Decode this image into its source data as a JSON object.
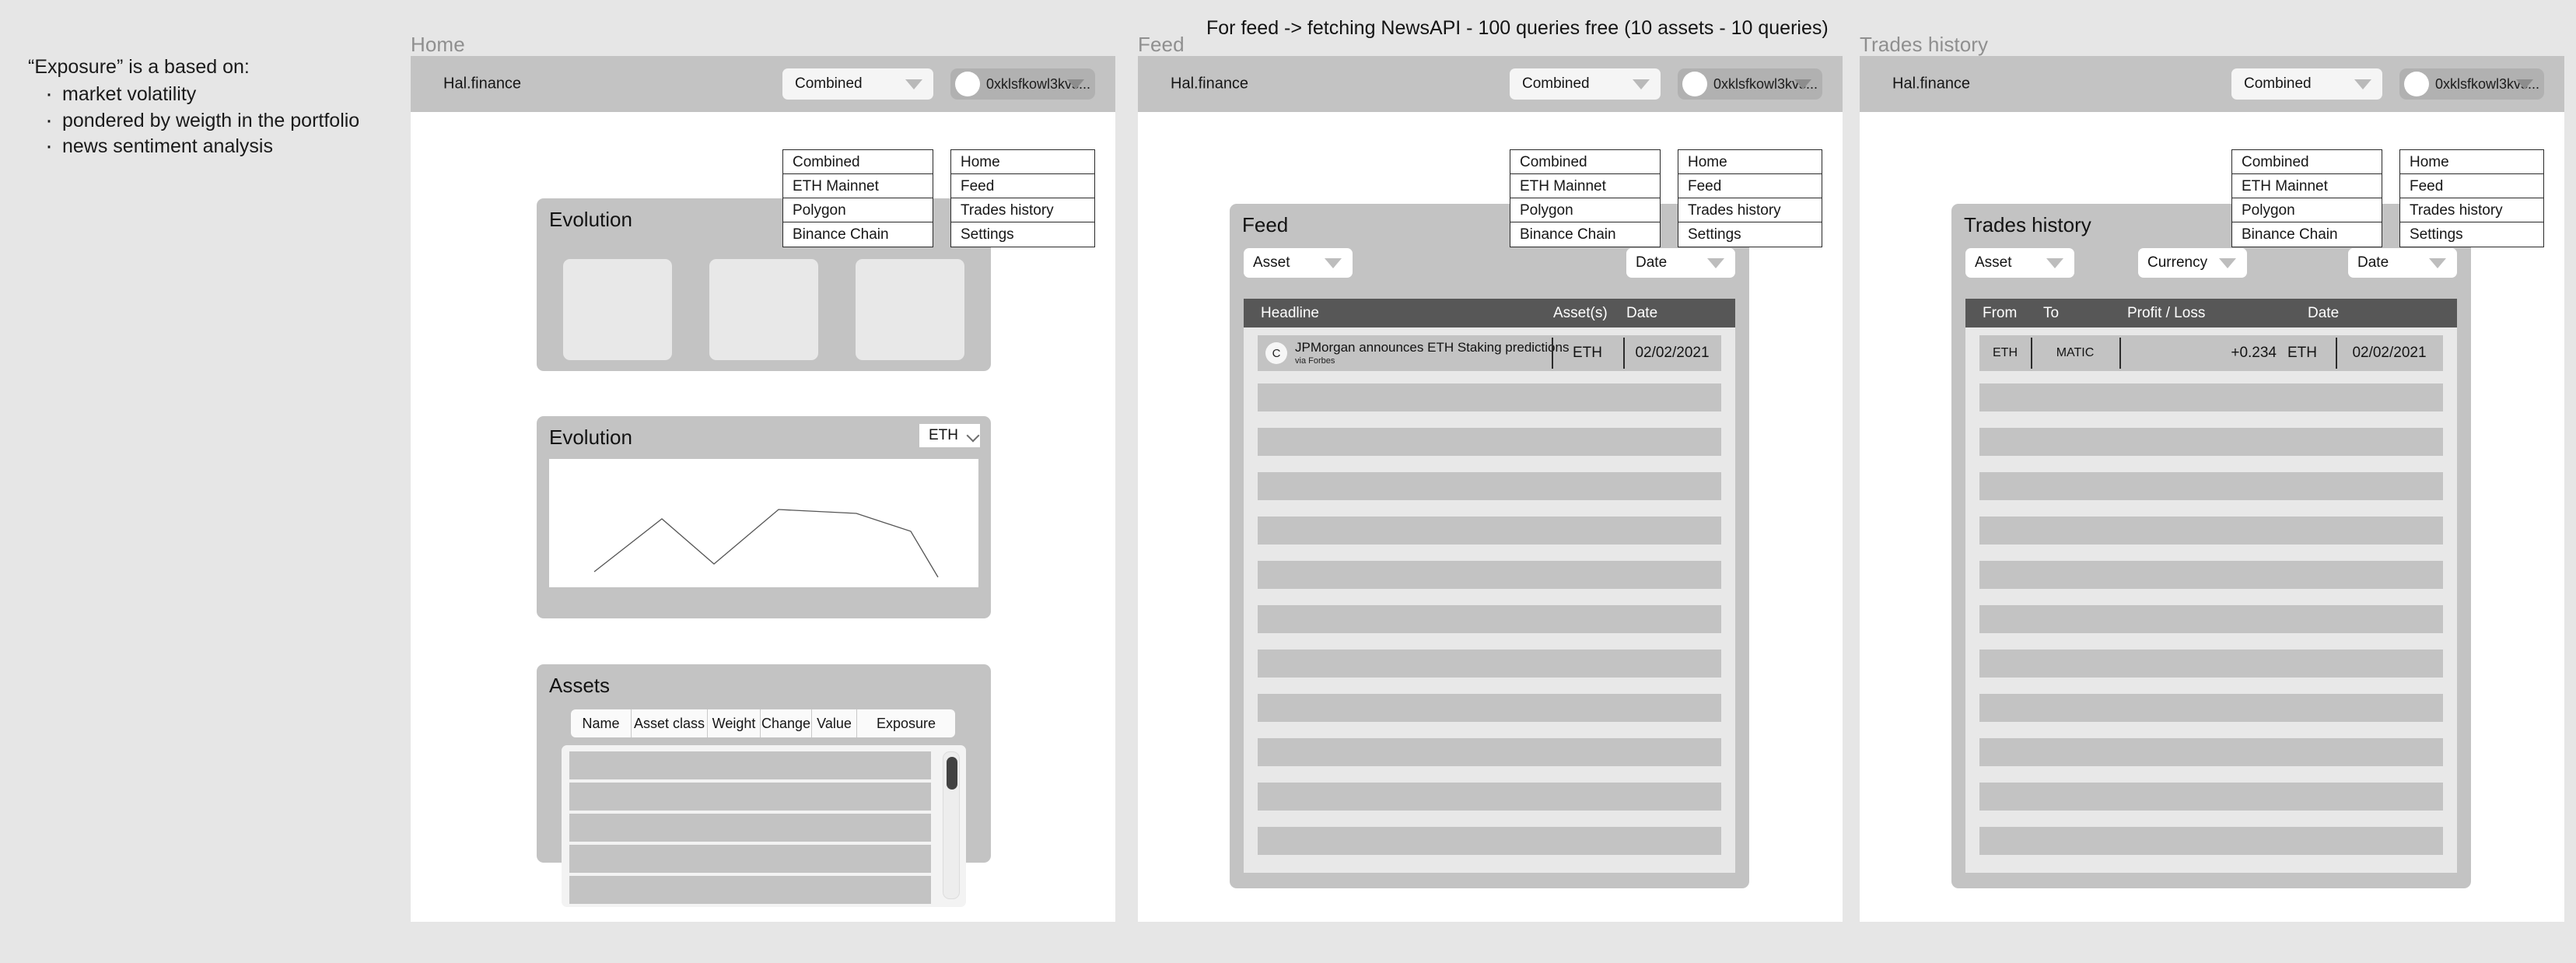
{
  "note": {
    "title": "“Exposure” is a based on:",
    "items": [
      "market volatility",
      "pondered by weigth in the portfolio",
      "news sentiment analysis"
    ]
  },
  "top_note": "For feed -> fetching NewsAPI - 100 queries free (10 assets - 10 queries)",
  "common": {
    "brand": "Hal.finance",
    "network_value": "Combined",
    "network_options": [
      "Combined",
      "ETH Mainnet",
      "Polygon",
      "Binance Chain"
    ],
    "account_value": "0xklsfkowl3kvs...",
    "account_menu": [
      "Home",
      "Feed",
      "Trades history",
      "Settings"
    ]
  },
  "screens": [
    {
      "label": "Home"
    },
    {
      "label": "Feed"
    },
    {
      "label": "Trades history"
    }
  ],
  "home": {
    "evolution_cards_title": "Evolution",
    "evolution_chart_title": "Evolution",
    "chart_asset": "ETH",
    "assets_title": "Assets",
    "assets_columns": [
      "Name",
      "Asset class",
      "Weight",
      "Change",
      "Value",
      "Exposure"
    ]
  },
  "chart_data": {
    "type": "line",
    "title": "Evolution",
    "series": [
      {
        "name": "ETH",
        "x": [
          0,
          1,
          2,
          3,
          4,
          5,
          6
        ],
        "values": [
          12,
          58,
          24,
          72,
          69,
          50,
          5
        ]
      }
    ],
    "xlabel": "",
    "ylabel": "",
    "ylim": [
      0,
      100
    ],
    "xlim": [
      0,
      6
    ],
    "grid": false,
    "legend": false
  },
  "feed": {
    "card_title": "Feed",
    "filters": [
      {
        "label": "Asset"
      },
      {
        "label": "Date"
      }
    ],
    "columns": [
      "Headline",
      "Asset(s)",
      "Date"
    ],
    "rows": [
      {
        "avatar": "C",
        "headline": "JPMorgan announces ETH Staking predictions",
        "source": "via Forbes",
        "asset": "ETH",
        "date": "02/02/2021"
      }
    ],
    "placeholder_row_count": 11
  },
  "trades": {
    "card_title": "Trades history",
    "filters": [
      {
        "label": "Asset"
      },
      {
        "label": "Currency"
      },
      {
        "label": "Date"
      }
    ],
    "columns": [
      "From",
      "To",
      "Profit / Loss",
      "Date"
    ],
    "rows": [
      {
        "from": "ETH",
        "to": "MATIC",
        "pl": "+0.234",
        "pl_currency": "ETH",
        "date": "02/02/2021"
      }
    ],
    "placeholder_row_count": 11
  },
  "colors": {
    "page_bg": "#e6e6e6",
    "panel_bg": "#ffffff",
    "appbar": "#c3c3c3",
    "card": "#c3c3c3",
    "table_header": "#575757",
    "row": "#c3c3c3",
    "table_body_bg": "#e8e8e8"
  }
}
